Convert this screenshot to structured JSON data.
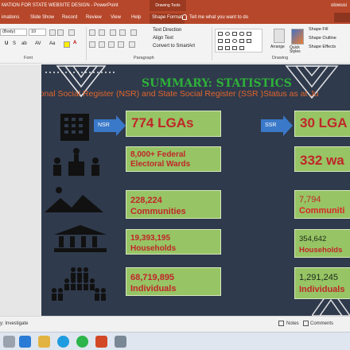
{
  "window": {
    "title": "MATION FOR STATE WEBSITE DESIGN  -  PowerPoint",
    "contextual_group": "Drawing Tools",
    "user": "olowusi"
  },
  "ribbon_tabs": [
    {
      "label": "imations"
    },
    {
      "label": "Slide Show"
    },
    {
      "label": "Record"
    },
    {
      "label": "Review"
    },
    {
      "label": "View"
    },
    {
      "label": "Help"
    },
    {
      "label": "Shape Format"
    }
  ],
  "tell_me": "Tell me what you want to do",
  "ribbon": {
    "font_name": "(Body)",
    "font_size": "10",
    "text_direction": "Text Direction",
    "align_text": "Align Text",
    "convert_smartart": "Convert to SmartArt",
    "arrange": "Arrange",
    "quick_styles": "Quick Styles",
    "shape_fill": "Shape Fill",
    "shape_outline": "Shape Outline",
    "shape_effects": "Shape Effects",
    "groups": {
      "font": "Font",
      "paragraph": "Paragraph",
      "drawing": "Drawing"
    }
  },
  "slide": {
    "title": "SUMMARY: STATISTICS",
    "subtitle": "National Social Register (NSR) and State Social Register (SSR )Status as at Ju",
    "nsr_arrow": "NSR",
    "ssr_arrow": "SSR",
    "nsr": {
      "lgas": "774 LGAs",
      "wards": [
        "8,000+ Federal",
        "Electoral Wards"
      ],
      "communities": [
        "228,224",
        "Communities"
      ],
      "households": [
        "19,393,195",
        "Households"
      ],
      "individuals": [
        "68,719,895",
        "Individuals"
      ]
    },
    "ssr": {
      "lgas": "30 LGA",
      "wards": "332 wa",
      "communities": [
        "7,794",
        "Communiti"
      ],
      "households": [
        "354,642",
        "Households"
      ],
      "individuals": [
        "1,291,245",
        "Individuals"
      ]
    }
  },
  "statusbar": {
    "accessibility": "y: Investigate",
    "notes": "Notes",
    "comments": "Comments"
  },
  "colors": {
    "ribbon_brand": "#b7472a",
    "slide_bg": "#2f3a4c",
    "title_green": "#2fb13a",
    "subtitle_orange": "#e2662c",
    "box_green": "#97c464",
    "value_red": "#c0262a",
    "arrow_blue": "#3a78c9"
  },
  "icons": [
    "building-icon",
    "podium-icon",
    "hills-icon",
    "bank-icon",
    "people-crowd-icon"
  ]
}
